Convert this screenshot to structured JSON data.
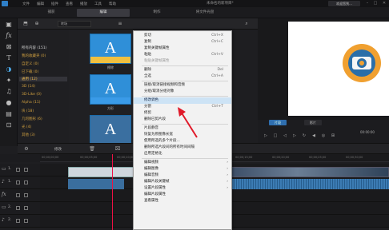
{
  "titlebar": {
    "menus": [
      "文件",
      "编辑",
      "插件",
      "查看",
      "播放",
      "工具",
      "帮助"
    ],
    "title": "未命名的新项目*",
    "user_button": "欢迎您到...",
    "controls": [
      "–",
      "□",
      "✕"
    ]
  },
  "modebar": {
    "tabs": [
      "捕获",
      "编辑",
      "制作",
      "将文件光盘"
    ],
    "active": "编辑"
  },
  "left_tools": [
    "media-icon",
    "fx-icon",
    "transition-icon",
    "title-icon",
    "pip-icon",
    "particle-icon",
    "audio-icon",
    "voice-icon",
    "chapter-icon",
    "subtitle-icon"
  ],
  "library": {
    "dropdown": "转场",
    "categories": [
      {
        "label": "所有内容 (151)",
        "color": "white"
      },
      {
        "label": "我的收藏夹 (0)",
        "color": "gold"
      },
      {
        "label": "自定义 (0)",
        "color": "gold"
      },
      {
        "label": "已下载 (0)",
        "color": "gold"
      },
      {
        "label": "通用 (12)",
        "color": "gold",
        "selected": true
      },
      {
        "label": "3D (14)",
        "color": "gold"
      },
      {
        "label": "3D-Like (0)",
        "color": "gold"
      },
      {
        "label": "Alpha (11)",
        "color": "gold"
      },
      {
        "label": "块 (18)",
        "color": "gold"
      },
      {
        "label": "几何图形 (6)",
        "color": "gold"
      },
      {
        "label": "光 (4)",
        "color": "gold"
      },
      {
        "label": "其他 (3)",
        "color": "gold"
      }
    ],
    "thumbs": [
      {
        "letter": "A",
        "label": "擦除"
      },
      {
        "letter": "A",
        "label": "方形"
      },
      {
        "letter": "A",
        "label": ""
      }
    ]
  },
  "preview": {
    "pill1": "片段",
    "pill2": "影片",
    "time": "00:00:00"
  },
  "timeline": {
    "toolbar_label": "修改",
    "ruler": [
      "00;00;00;00",
      "00;00;05;00",
      "00;00;10;00",
      "00;00;15;00",
      "00;00;20;00",
      "00;00;25;00",
      "00;00;30;00"
    ],
    "tracks": [
      {
        "num": "1.",
        "icon": "video-track-icon"
      },
      {
        "num": "1.",
        "icon": "audio-track-icon"
      },
      {
        "num": "",
        "icon": "fx-track-icon"
      },
      {
        "num": "2.",
        "icon": "video-track-icon"
      },
      {
        "num": "2.",
        "icon": "audio-track-icon"
      }
    ]
  },
  "context_menu": {
    "items": [
      {
        "label": "剪切",
        "shortcut": "Ctrl+X"
      },
      {
        "label": "复制",
        "shortcut": "Ctrl+C"
      },
      {
        "label": "复制关键帧属性",
        "shortcut": ""
      },
      {
        "label": "粘贴",
        "shortcut": "Ctrl+V"
      },
      {
        "label": "粘贴关键帧属性",
        "shortcut": "",
        "disabled": true
      },
      {
        "sep": true
      },
      {
        "label": "删除",
        "shortcut": "Del"
      },
      {
        "label": "全选",
        "shortcut": "Ctrl+A"
      },
      {
        "sep": true
      },
      {
        "label": "链接/取消链接视频和音频",
        "shortcut": ""
      },
      {
        "label": "分组/取消分组对象",
        "shortcut": ""
      },
      {
        "sep": true
      },
      {
        "label": "修改调色",
        "shortcut": "",
        "highlight": true
      },
      {
        "label": "分割",
        "shortcut": "Ctrl+T"
      },
      {
        "label": "修剪",
        "shortcut": ""
      },
      {
        "label": "删除已剪片段",
        "shortcut": ""
      },
      {
        "sep": true
      },
      {
        "label": "片段静音",
        "shortcut": ""
      },
      {
        "label": "恢复为原图像长宽",
        "shortcut": ""
      },
      {
        "label": "使用所选的多个片段...",
        "shortcut": ""
      },
      {
        "label": "删除所选片段间的所有时间间隔",
        "shortcut": ""
      },
      {
        "label": "启用定格化",
        "shortcut": ""
      },
      {
        "sep": true
      },
      {
        "label": "编辑视频",
        "shortcut": "",
        "arrow": true
      },
      {
        "label": "编辑图像",
        "shortcut": "",
        "arrow": true
      },
      {
        "label": "编辑音频",
        "shortcut": "",
        "arrow": true
      },
      {
        "label": "编辑片段关键帧",
        "shortcut": "",
        "arrow": true
      },
      {
        "label": "设置片段属性",
        "shortcut": "",
        "arrow": true
      },
      {
        "label": "编辑片段属性",
        "shortcut": ""
      },
      {
        "label": "查看属性",
        "shortcut": ""
      }
    ]
  }
}
